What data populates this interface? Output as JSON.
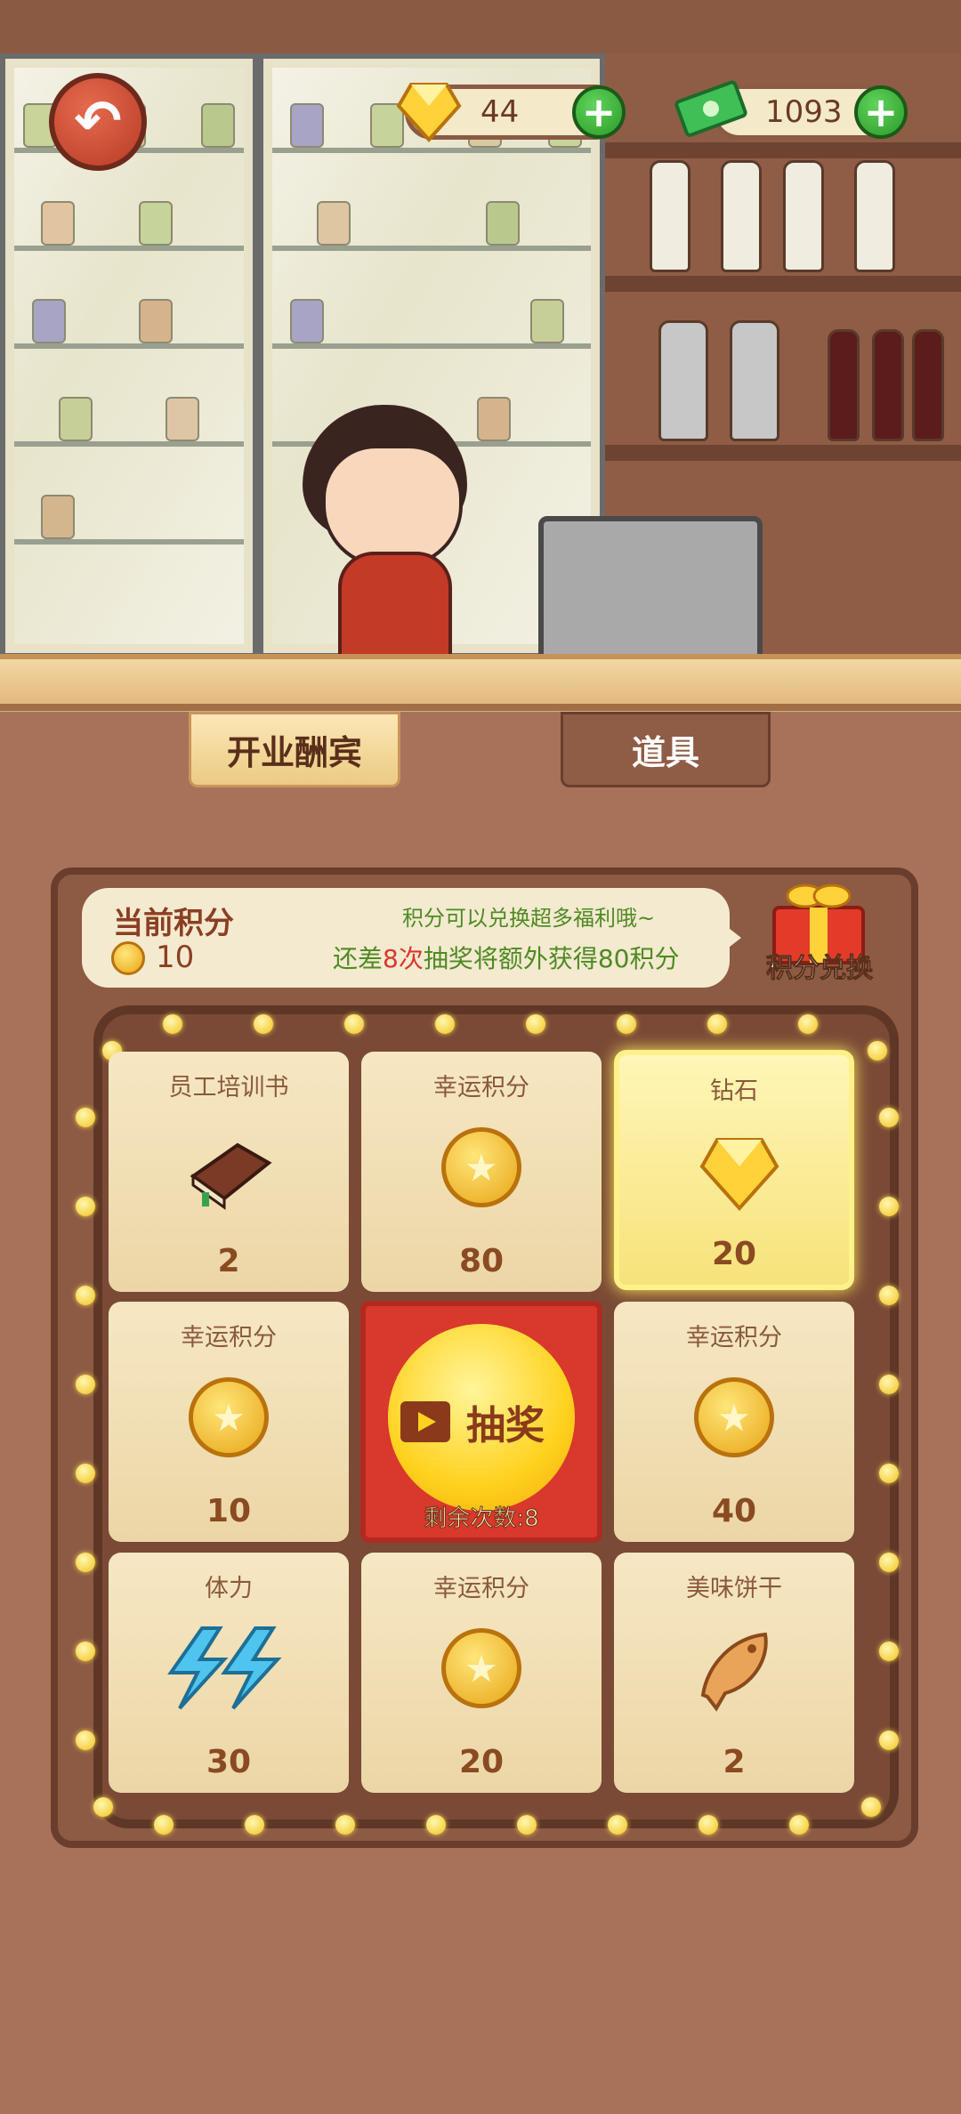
{
  "hud": {
    "diamonds": "44",
    "cash": "1093"
  },
  "tabs": [
    {
      "label": "开业酬宾",
      "active": true
    },
    {
      "label": "道具",
      "active": false
    }
  ],
  "points": {
    "current_label": "当前积分",
    "current_value": "10",
    "hint_line1": "积分可以兑换超多福利哦~",
    "hint_prefix": "还差",
    "hint_count": "8次",
    "hint_suffix": "抽奖将额外获得80积分",
    "exchange_label": "积分兑换"
  },
  "prizes": [
    {
      "title": "员工培训书",
      "value": "2",
      "icon": "book-icon"
    },
    {
      "title": "幸运积分",
      "value": "80",
      "icon": "coin-icon"
    },
    {
      "title": "钻石",
      "value": "20",
      "icon": "diamond-icon",
      "highlighted": true
    },
    {
      "title": "幸运积分",
      "value": "10",
      "icon": "coin-icon"
    },
    {
      "title": "幸运积分",
      "value": "40",
      "icon": "coin-icon"
    },
    {
      "title": "体力",
      "value": "30",
      "icon": "lightning-icon"
    },
    {
      "title": "幸运积分",
      "value": "20",
      "icon": "coin-icon"
    },
    {
      "title": "美味饼干",
      "value": "2",
      "icon": "fish-cookie-icon"
    }
  ],
  "draw": {
    "label": "抽奖",
    "remaining": "剩余次数:8"
  },
  "colors": {
    "accent_red": "#d9382c",
    "highlight_yellow": "#fff18a",
    "panel_brown": "#8d5a44"
  }
}
